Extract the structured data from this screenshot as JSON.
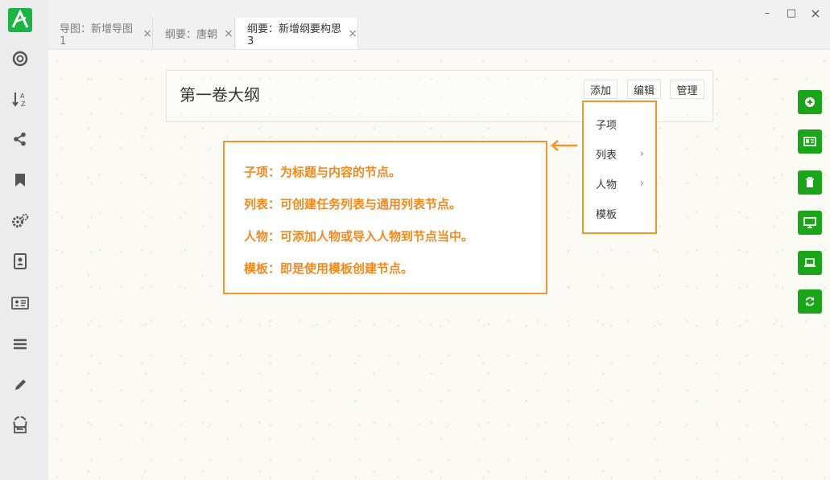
{
  "tabs": [
    {
      "label": "导图：新增导图1",
      "close": "×",
      "active": false
    },
    {
      "label": "纲要：唐朝",
      "close": "×",
      "active": false
    },
    {
      "label": "纲要：新增纲要构思3",
      "close": "×",
      "active": true
    }
  ],
  "window": {
    "minimize": "–",
    "maximize": "□",
    "close": "×"
  },
  "outline": {
    "title": "第一卷大纲",
    "buttons": {
      "add": "添加",
      "edit": "编辑",
      "manage": "管理"
    }
  },
  "dropdown": {
    "items": [
      {
        "label": "子项",
        "has_submenu": false
      },
      {
        "label": "列表",
        "has_submenu": true
      },
      {
        "label": "人物",
        "has_submenu": true
      },
      {
        "label": "模板",
        "has_submenu": false
      }
    ],
    "chevron": "›"
  },
  "callout": {
    "lines": [
      "子项：为标题与内容的节点。",
      "列表：可创建任务列表与通用列表节点。",
      "人物：可添加人物或导入人物到节点当中。",
      "模板：即是使用模板创建节点。"
    ]
  },
  "sidebar_icons": [
    "lifebuoy-icon",
    "sort-az-icon",
    "share-icon",
    "bookmark-icon",
    "gears-icon",
    "contacts-book-icon",
    "id-card-icon",
    "list-icon",
    "pencil-icon",
    "recycle-bin-icon"
  ],
  "right_actions": [
    "add-circle-icon",
    "card-icon",
    "trash-icon",
    "monitor-icon",
    "laptop-icon",
    "refresh-icon"
  ],
  "colors": {
    "accent": "#f2962b",
    "green": "#1aa51a",
    "logo": "#1db446"
  }
}
